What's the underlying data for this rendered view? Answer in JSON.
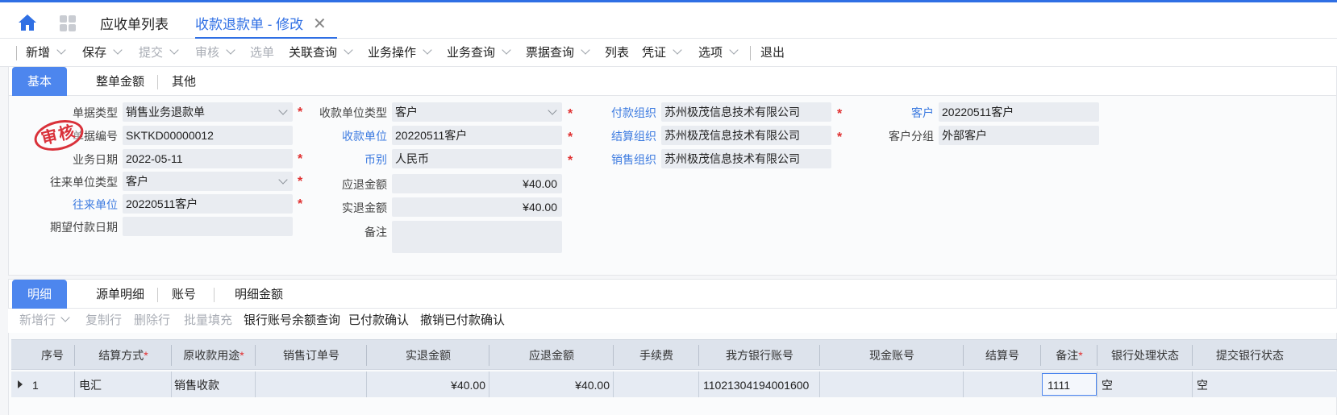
{
  "tabs": {
    "list": "应收单列表",
    "active": "收款退款单 - 修改",
    "close": "✕"
  },
  "toolbar": {
    "new": "新增",
    "save": "保存",
    "submit": "提交",
    "audit": "审核",
    "select": "选单",
    "related_query": "关联查询",
    "biz_ops": "业务操作",
    "biz_query": "业务查询",
    "bill_query": "票据查询",
    "list": "列表",
    "voucher": "凭证",
    "options": "选项",
    "exit": "退出"
  },
  "header_tabs": {
    "basic": "基本",
    "total_amount": "整单金额",
    "other": "其他"
  },
  "form": {
    "bill_type_label": "单据类型",
    "bill_type": "销售业务退款单",
    "bill_no_label": "单据编号",
    "bill_no": "SKTKD00000012",
    "biz_date_label": "业务日期",
    "biz_date": "2022-05-11",
    "contact_type_label": "往来单位类型",
    "contact_type": "客户",
    "contact_label": "往来单位",
    "contact": "20220511客户",
    "expect_pay_date_label": "期望付款日期",
    "expect_pay_date": "",
    "recv_unit_type_label": "收款单位类型",
    "recv_unit_type": "客户",
    "recv_unit_label": "收款单位",
    "recv_unit": "20220511客户",
    "currency_label": "币别",
    "currency": "人民币",
    "due_refund_label": "应退金额",
    "due_refund": "¥40.00",
    "actual_refund_label": "实退金额",
    "actual_refund": "¥40.00",
    "remark_label": "备注",
    "remark": "",
    "pay_org_label": "付款组织",
    "pay_org": "苏州极茂信息技术有限公司",
    "settle_org_label": "结算组织",
    "settle_org": "苏州极茂信息技术有限公司",
    "sales_org_label": "销售组织",
    "sales_org": "苏州极茂信息技术有限公司",
    "customer_label": "客户",
    "customer": "20220511客户",
    "customer_group_label": "客户分组",
    "customer_group": "外部客户",
    "required_mark": "*",
    "stamp": "审核"
  },
  "detail_tabs": {
    "detail": "明细",
    "source_detail": "源单明细",
    "account": "账号",
    "detail_amount": "明细金额"
  },
  "detail_actions": {
    "add_row": "新增行",
    "copy_row": "复制行",
    "delete_row": "删除行",
    "batch_fill": "批量填充",
    "bank_balance_query": "银行账号余额查询",
    "confirm_paid": "已付款确认",
    "cancel_paid": "撤销已付款确认"
  },
  "grid": {
    "columns": [
      "序号",
      "结算方式",
      "原收款用途",
      "销售订单号",
      "实退金额",
      "应退金额",
      "手续费",
      "我方银行账号",
      "现金账号",
      "结算号",
      "备注",
      "银行处理状态",
      "提交银行状态"
    ],
    "rows": [
      {
        "seq": "1",
        "settle_method": "电汇",
        "purpose": "销售收款",
        "order_no": "",
        "actual": "¥40.00",
        "due": "¥40.00",
        "fee": "",
        "bank_account": "11021304194001600",
        "cash_account": "",
        "settle_no": "",
        "remark": "1111",
        "bank_status": "空",
        "submit_status": "空"
      }
    ]
  },
  "colors": {
    "accent": "#2f6fe4",
    "tab_active_bg": "#4d86ee",
    "required": "#e03030",
    "stamp": "#d9313a"
  }
}
